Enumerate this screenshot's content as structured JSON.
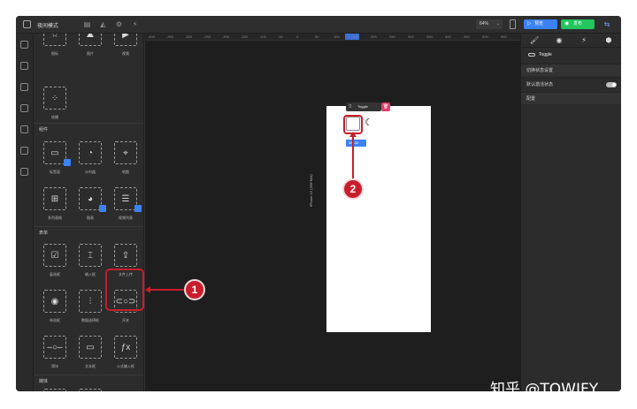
{
  "app": {
    "title": "夜间模式"
  },
  "toolbar": {
    "zoom": "64%",
    "preview_label": "预览",
    "publish_label": "发布"
  },
  "panel": {
    "sections": {
      "components": "组件",
      "form": "表单",
      "media": "媒体"
    },
    "top_row": [
      "图标",
      "图片",
      "视频"
    ],
    "single": [
      "轮播"
    ],
    "components": [
      "标签面",
      "计时器",
      "地图",
      "多列表格",
      "图表",
      "视频列表"
    ],
    "form_row1": [
      "复选框",
      "输入框",
      "文件上传"
    ],
    "form_row2": [
      "单选框",
      "数据选择框",
      "开关"
    ],
    "form_row3": [
      "滑块",
      "文本框",
      "公式输入框"
    ]
  },
  "canvas": {
    "ruler_ticks": [
      "-400",
      "-350",
      "-300",
      "-250",
      "-200",
      "-150",
      "-100",
      "-50",
      "0",
      "50",
      "100",
      "150",
      "200",
      "250",
      "300",
      "350",
      "400",
      "450",
      "500",
      "550"
    ],
    "device_label": "iPhone 12 (390*844)",
    "selected_component": "Toggle",
    "size_chip": "36×30"
  },
  "right_panel": {
    "component_name": "Toggle",
    "rows": [
      "切换状态设置",
      "默认激活状态",
      "配置"
    ]
  },
  "callouts": [
    "1",
    "2"
  ],
  "watermark": "知乎 @TOWIFY"
}
